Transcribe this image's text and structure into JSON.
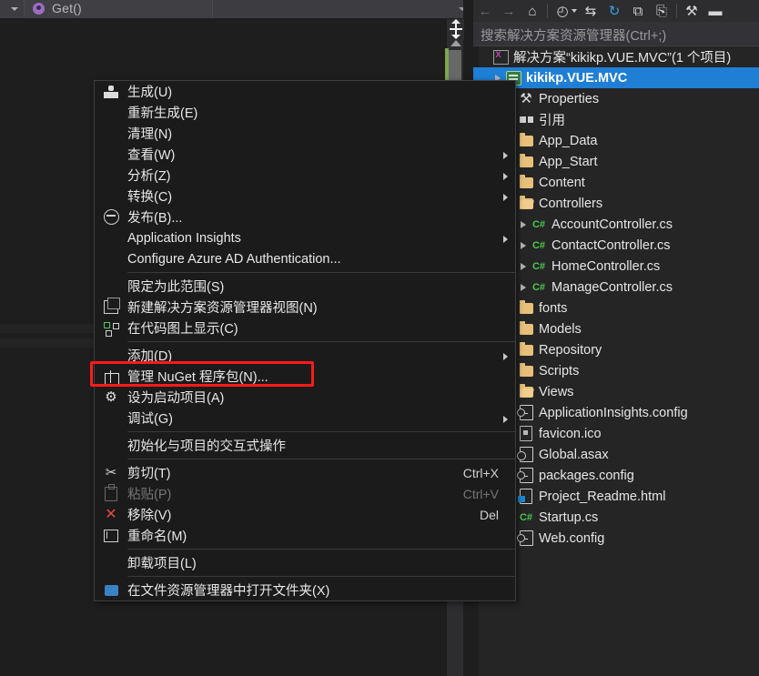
{
  "editor": {
    "navbar": {
      "member_dropdown_value": "Get()",
      "left_dropdown_value": ""
    },
    "scrollbar": {
      "up_arrow": "scroll-up"
    }
  },
  "solution_explorer": {
    "toolbar": [
      {
        "name": "back-icon",
        "glyph": "←",
        "enabled": false
      },
      {
        "name": "forward-icon",
        "glyph": "→",
        "enabled": false
      },
      {
        "name": "home-icon",
        "glyph": "⌂",
        "enabled": true
      },
      {
        "name": "pending-changes-icon",
        "glyph": "◴",
        "enabled": true
      },
      {
        "name": "sync-with-active-document-icon",
        "glyph": "⇆",
        "enabled": true
      },
      {
        "name": "refresh-icon",
        "glyph": "↻",
        "enabled": true
      },
      {
        "name": "collapse-all-icon",
        "glyph": "⧉",
        "enabled": true
      },
      {
        "name": "show-all-files-icon",
        "glyph": "⎘",
        "enabled": true
      },
      {
        "name": "properties-icon",
        "glyph": "⚒",
        "enabled": true
      },
      {
        "name": "preview-selected-items-icon",
        "glyph": "▬",
        "enabled": true
      }
    ],
    "search": {
      "placeholder": "搜索解决方案资源管理器(Ctrl+;)"
    },
    "tree": [
      {
        "label": "解决方案“kikikp.VUE.MVC”(1 个项目)",
        "icon": "solution-icon",
        "indent": 0,
        "expander": false,
        "selected": false
      },
      {
        "label": "kikikp.VUE.MVC",
        "icon": "project-icon",
        "indent": 1,
        "expander": true,
        "selected": true
      },
      {
        "label": "Properties",
        "icon": "wrench-icon",
        "indent": 2,
        "expander": false,
        "selected": false
      },
      {
        "label": "引用",
        "icon": "references-icon",
        "indent": 2,
        "expander": false,
        "selected": false
      },
      {
        "label": "App_Data",
        "icon": "folder-icon",
        "indent": 2,
        "expander": false,
        "selected": false
      },
      {
        "label": "App_Start",
        "icon": "folder-icon",
        "indent": 2,
        "expander": false,
        "selected": false
      },
      {
        "label": "Content",
        "icon": "folder-icon",
        "indent": 2,
        "expander": false,
        "selected": false
      },
      {
        "label": "Controllers",
        "icon": "folder-open-icon",
        "indent": 2,
        "expander": false,
        "selected": false
      },
      {
        "label": "AccountController.cs",
        "icon": "csharp-file-icon",
        "indent": 3,
        "expander": true,
        "selected": false
      },
      {
        "label": "ContactController.cs",
        "icon": "csharp-file-icon",
        "indent": 3,
        "expander": true,
        "selected": false
      },
      {
        "label": "HomeController.cs",
        "icon": "csharp-file-icon",
        "indent": 3,
        "expander": true,
        "selected": false
      },
      {
        "label": "ManageController.cs",
        "icon": "csharp-file-icon",
        "indent": 3,
        "expander": true,
        "selected": false
      },
      {
        "label": "fonts",
        "icon": "folder-icon",
        "indent": 2,
        "expander": false,
        "selected": false
      },
      {
        "label": "Models",
        "icon": "folder-icon",
        "indent": 2,
        "expander": false,
        "selected": false
      },
      {
        "label": "Repository",
        "icon": "folder-icon",
        "indent": 2,
        "expander": false,
        "selected": false
      },
      {
        "label": "Scripts",
        "icon": "folder-icon",
        "indent": 2,
        "expander": false,
        "selected": false
      },
      {
        "label": "Views",
        "icon": "folder-open-icon",
        "indent": 2,
        "expander": false,
        "selected": false
      },
      {
        "label": "ApplicationInsights.config",
        "icon": "config-file-icon",
        "indent": 2,
        "expander": false,
        "selected": false
      },
      {
        "label": "favicon.ico",
        "icon": "ico-file-icon",
        "indent": 2,
        "expander": false,
        "selected": false
      },
      {
        "label": "Global.asax",
        "icon": "asax-file-icon",
        "indent": 2,
        "expander": false,
        "selected": false
      },
      {
        "label": "packages.config",
        "icon": "config-file-icon",
        "indent": 2,
        "expander": false,
        "selected": false
      },
      {
        "label": "Project_Readme.html",
        "icon": "html-file-icon",
        "indent": 2,
        "expander": false,
        "selected": false
      },
      {
        "label": "Startup.cs",
        "icon": "csharp-file-icon",
        "indent": 2,
        "expander": false,
        "selected": false
      },
      {
        "label": "Web.config",
        "icon": "config-file-icon",
        "indent": 2,
        "expander": false,
        "selected": false
      }
    ]
  },
  "context_menu": {
    "highlight_color": "#ff1a1a",
    "items": [
      {
        "label": "生成(U)",
        "icon": "build-icon",
        "accel": "",
        "submenu": false,
        "disabled": false,
        "highlighted": false
      },
      {
        "label": "重新生成(E)",
        "icon": "",
        "accel": "",
        "submenu": false,
        "disabled": false,
        "highlighted": false
      },
      {
        "label": "清理(N)",
        "icon": "",
        "accel": "",
        "submenu": false,
        "disabled": false,
        "highlighted": false
      },
      {
        "label": "查看(W)",
        "icon": "",
        "accel": "",
        "submenu": true,
        "disabled": false,
        "highlighted": false
      },
      {
        "label": "分析(Z)",
        "icon": "",
        "accel": "",
        "submenu": true,
        "disabled": false,
        "highlighted": false
      },
      {
        "label": "转换(C)",
        "icon": "",
        "accel": "",
        "submenu": true,
        "disabled": false,
        "highlighted": false
      },
      {
        "label": "发布(B)...",
        "icon": "publish-icon",
        "accel": "",
        "submenu": false,
        "disabled": false,
        "highlighted": false
      },
      {
        "label": "Application Insights",
        "icon": "",
        "accel": "",
        "submenu": true,
        "disabled": false,
        "highlighted": false
      },
      {
        "label": "Configure Azure AD Authentication...",
        "icon": "",
        "accel": "",
        "submenu": false,
        "disabled": false,
        "highlighted": false
      },
      {
        "separator": true
      },
      {
        "label": "限定为此范围(S)",
        "icon": "",
        "accel": "",
        "submenu": false,
        "disabled": false,
        "highlighted": false
      },
      {
        "label": "新建解决方案资源管理器视图(N)",
        "icon": "new-solution-explorer-view-icon",
        "accel": "",
        "submenu": false,
        "disabled": false,
        "highlighted": false
      },
      {
        "label": "在代码图上显示(C)",
        "icon": "code-map-icon",
        "accel": "",
        "submenu": false,
        "disabled": false,
        "highlighted": false
      },
      {
        "separator": true
      },
      {
        "label": "添加(D)",
        "icon": "",
        "accel": "",
        "submenu": true,
        "disabled": false,
        "highlighted": false
      },
      {
        "label": "管理 NuGet 程序包(N)...",
        "icon": "nuget-icon",
        "accel": "",
        "submenu": false,
        "disabled": false,
        "highlighted": true
      },
      {
        "label": "设为启动项目(A)",
        "icon": "gear-icon",
        "accel": "",
        "submenu": false,
        "disabled": false,
        "highlighted": false
      },
      {
        "label": "调试(G)",
        "icon": "",
        "accel": "",
        "submenu": true,
        "disabled": false,
        "highlighted": false
      },
      {
        "separator": true
      },
      {
        "label": "初始化与项目的交互式操作",
        "icon": "",
        "accel": "",
        "submenu": false,
        "disabled": false,
        "highlighted": false
      },
      {
        "separator": true
      },
      {
        "label": "剪切(T)",
        "icon": "cut-icon",
        "accel": "Ctrl+X",
        "submenu": false,
        "disabled": false,
        "highlighted": false
      },
      {
        "label": "粘贴(P)",
        "icon": "paste-icon",
        "accel": "Ctrl+V",
        "submenu": false,
        "disabled": true,
        "highlighted": false
      },
      {
        "label": "移除(V)",
        "icon": "remove-icon",
        "accel": "Del",
        "submenu": false,
        "disabled": false,
        "highlighted": false
      },
      {
        "label": "重命名(M)",
        "icon": "rename-icon",
        "accel": "",
        "submenu": false,
        "disabled": false,
        "highlighted": false
      },
      {
        "separator": true
      },
      {
        "label": "卸载项目(L)",
        "icon": "",
        "accel": "",
        "submenu": false,
        "disabled": false,
        "highlighted": false
      },
      {
        "separator": true
      },
      {
        "label": "在文件资源管理器中打开文件夹(X)",
        "icon": "open-folder-icon",
        "accel": "",
        "submenu": false,
        "disabled": false,
        "highlighted": false
      }
    ]
  }
}
